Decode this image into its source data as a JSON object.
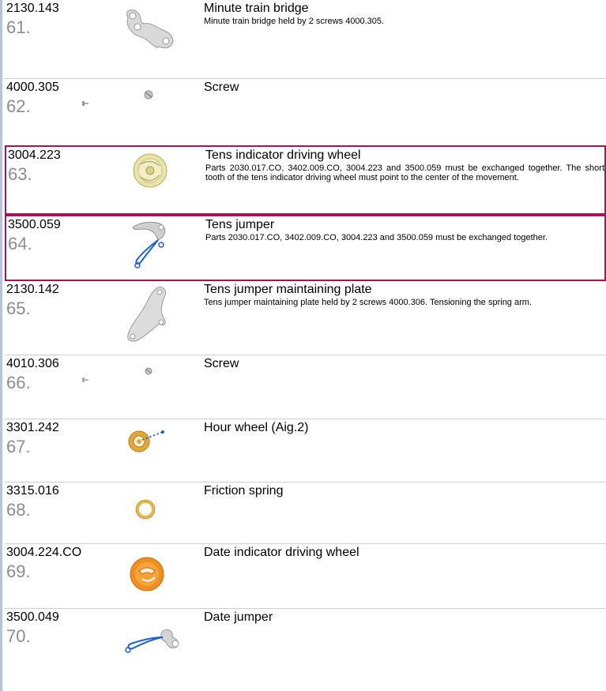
{
  "parts": [
    {
      "part_no": "2130.143",
      "index": "61.",
      "title": "Minute train bridge",
      "desc": "Minute train bridge held by 2 screws 4000.305.",
      "icon": "bridge-icon"
    },
    {
      "part_no": "4000.305",
      "index": "62.",
      "title": "Screw",
      "desc": "",
      "icon": "screw-icon"
    },
    {
      "part_no": "3004.223",
      "index": "63.",
      "title": "Tens indicator driving wheel",
      "desc": "Parts 2030.017.CO, 3402.009.CO, 3004.223 and 3500.059 must be exchanged together.  The short tooth of the tens indicator driving wheel must point to the center of the movement.",
      "icon": "gear-wheel-icon"
    },
    {
      "part_no": "3500.059",
      "index": "64.",
      "title": "Tens jumper",
      "desc": "Parts 2030.017.CO, 3402.009.CO, 3004.223 and 3500.059 must be exchanged together.",
      "icon": "jumper-icon"
    },
    {
      "part_no": "2130.142",
      "index": "65.",
      "title": "Tens jumper maintaining plate",
      "desc": "Tens jumper maintaining plate held by 2 screws 4000.306. Tensioning the spring arm.",
      "icon": "plate-icon"
    },
    {
      "part_no": "4010.306",
      "index": "66.",
      "title": "Screw",
      "desc": "",
      "icon": "screw-icon"
    },
    {
      "part_no": "3301.242",
      "index": "67.",
      "title": "Hour wheel (Aig.2)",
      "desc": "",
      "icon": "hour-wheel-icon"
    },
    {
      "part_no": "3315.016",
      "index": "68.",
      "title": "Friction spring",
      "desc": "",
      "icon": "friction-spring-icon"
    },
    {
      "part_no": "3004.224.CO",
      "index": "69.",
      "title": "Date indicator driving wheel",
      "desc": "",
      "icon": "date-wheel-icon"
    },
    {
      "part_no": "3500.049",
      "index": "70.",
      "title": "Date jumper",
      "desc": "",
      "icon": "date-jumper-icon"
    }
  ],
  "colors": {
    "highlight_border": "#a4145a",
    "index_text": "#8c8c8c",
    "left_bar": "#b8c4dc",
    "blue_marker": "#1e5fd0"
  }
}
